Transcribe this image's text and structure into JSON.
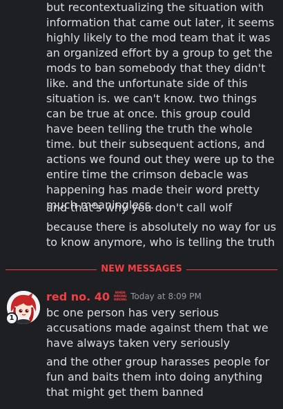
{
  "previous_messages": {
    "paragraph": "but recontextualizing the situation with information that came out later, it seems highly likely to the mod team that it was an organized effort by a group to get the mods to ban somebody that they didn't like. and the unfortunate side of this situation is. we can't know. two things can be true at once. this group could have been telling the truth the whole time. but their subsequent actions, and actions we found out they were up to the entire time the crimson debacle was happening has made their word pretty much meaningless.",
    "wolf_line": "and that's why you don't call wolf",
    "truth_line": "because there is absolutely no way for us to know anymore, who is telling the truth"
  },
  "divider": {
    "label": "NEW MESSAGES",
    "color": "#f23f43"
  },
  "new_message": {
    "author": "red no. 40",
    "author_color": "#f23f43",
    "role_tag_lines": [
      "WHEN",
      "WRONG",
      "WRONG"
    ],
    "timestamp": "Today at 8:09 PM",
    "avatar_badge": "1",
    "paragraphs": [
      "bc one person has very serious accusations made against them that we have always taken very seriously",
      "and the other group harasses people for fun and baits them into doing anything that might get them banned"
    ]
  },
  "colors": {
    "background": "#1e1f22",
    "text": "#dbdee1",
    "muted": "#949ba4",
    "accent_red": "#f23f43"
  },
  "icons": {
    "avatar": "red-haired-character-avatar",
    "role_tag": "red-text-tag-icon"
  }
}
